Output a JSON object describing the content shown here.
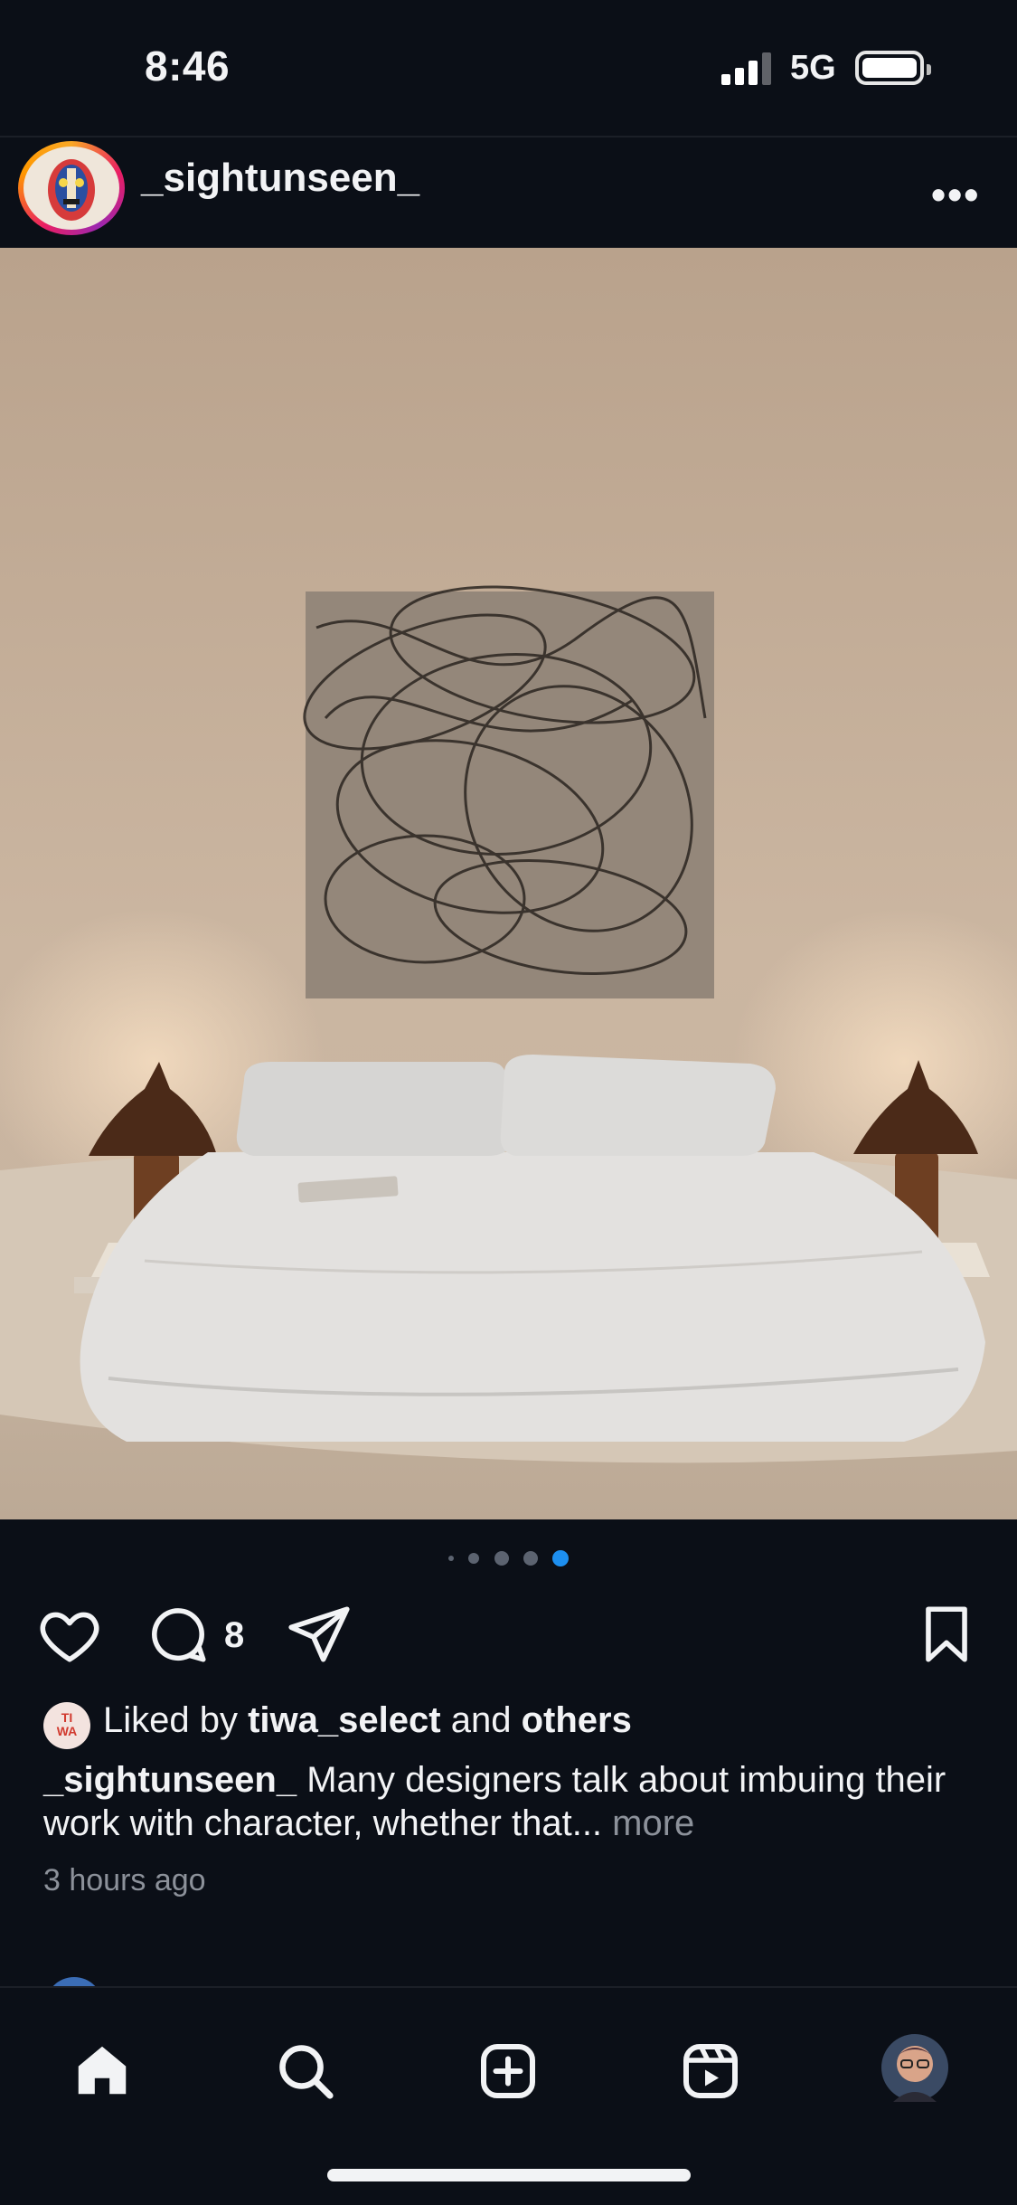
{
  "status": {
    "time": "8:46",
    "network": "5G"
  },
  "post": {
    "username": "_sightunseen_",
    "image_alt": "Bedroom photo",
    "pager": {
      "count": 5,
      "active": 5
    },
    "comment_count": "8",
    "liked": {
      "prefix": "Liked by",
      "user": "tiwa_select",
      "middle": "and",
      "others": "others",
      "avatar_text_line1": "TI",
      "avatar_text_line2": "WA"
    },
    "caption": {
      "username": "_sightunseen_",
      "text": "Many designers talk about imbuing their work with character, whether that...",
      "more": "more"
    },
    "timestamp": "3 hours ago"
  },
  "icons": {
    "post_menu": "more-horizontal-icon",
    "actions": [
      "heart-icon",
      "comment-icon",
      "share-icon",
      "bookmark-icon"
    ],
    "tabs": [
      "home-icon",
      "search-icon",
      "create-icon",
      "reels-icon",
      "profile-avatar"
    ]
  },
  "colors": {
    "background": "#0b0f17",
    "accent_blue": "#1d8ff0"
  }
}
